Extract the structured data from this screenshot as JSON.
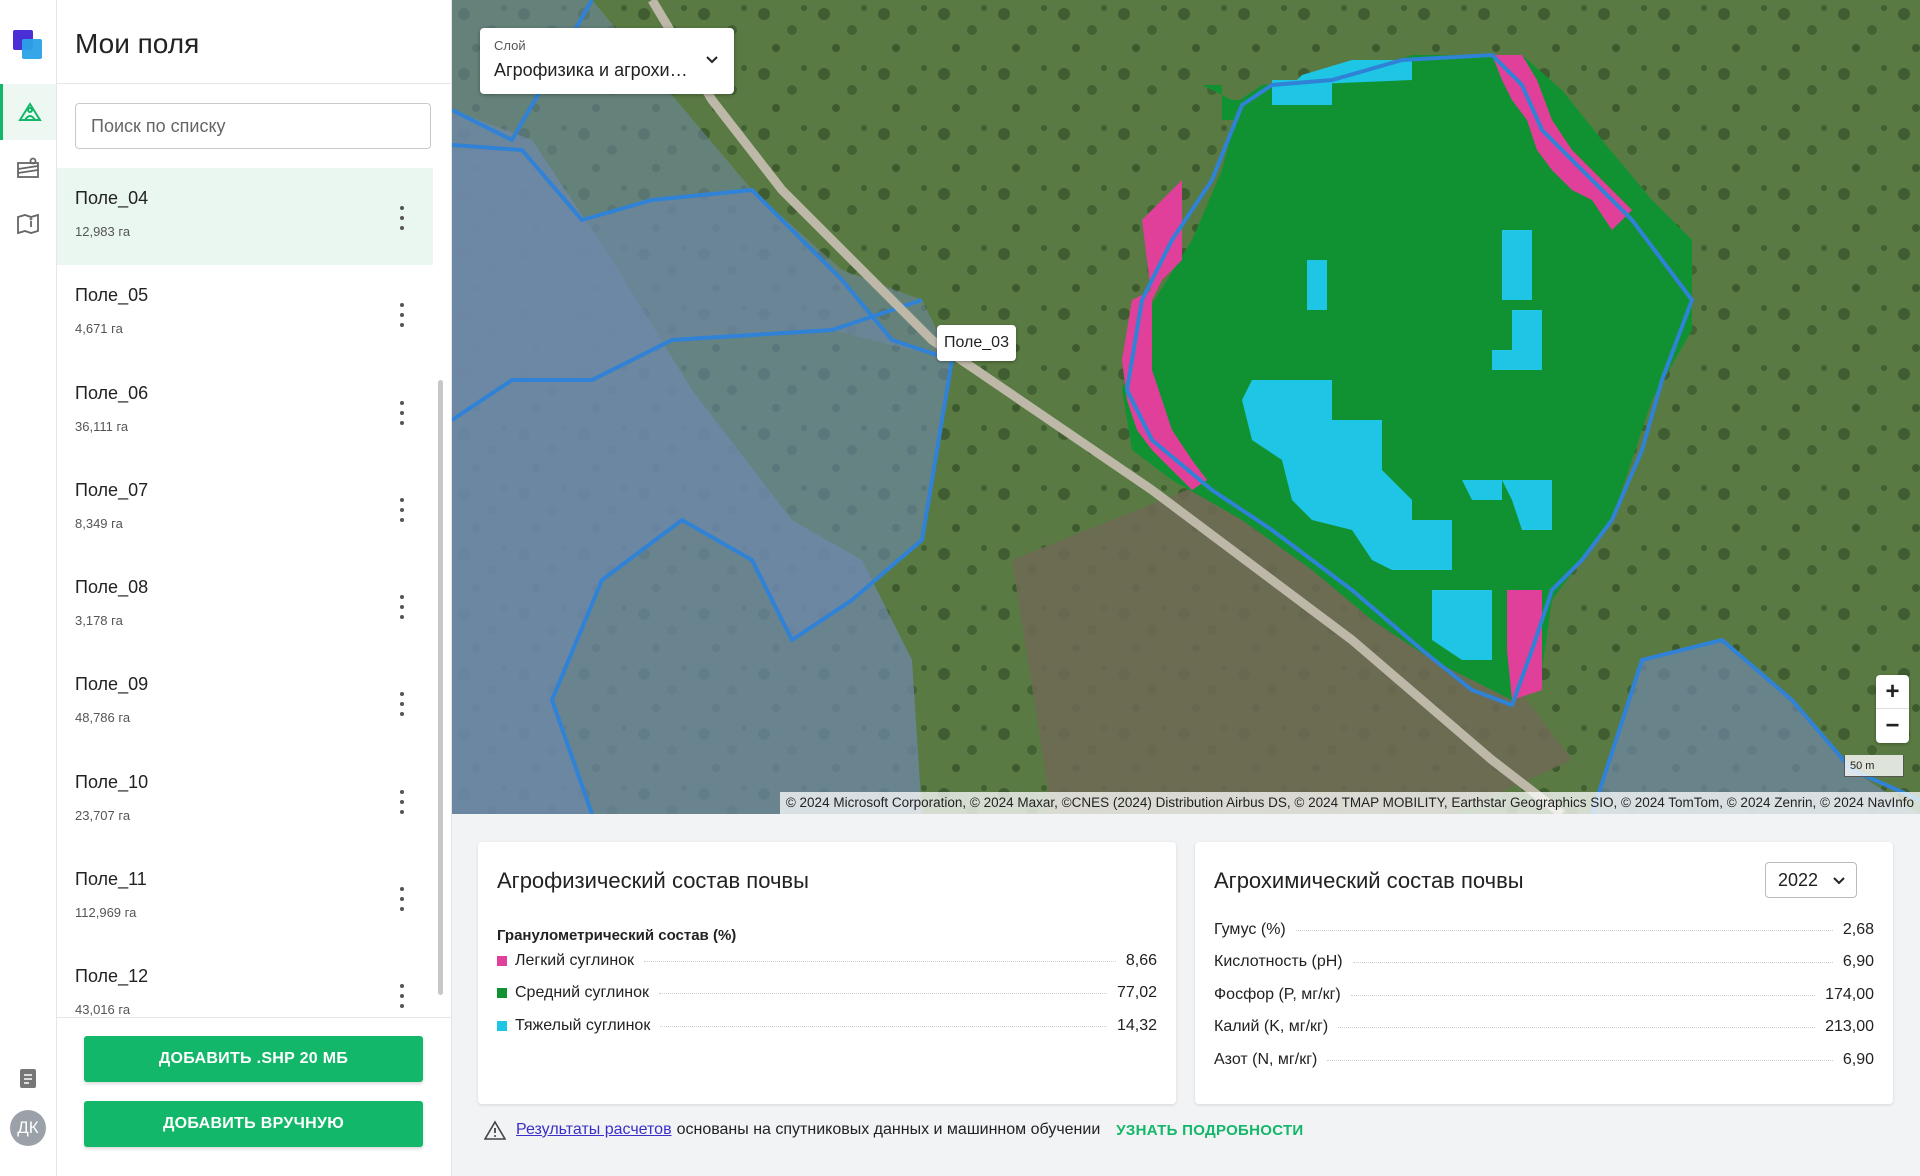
{
  "app": {
    "logo": "brand-logo"
  },
  "rail": {
    "items": [
      {
        "icon": "fields-icon",
        "active": true
      },
      {
        "icon": "weather-icon",
        "active": false
      },
      {
        "icon": "map-book-icon",
        "active": false
      }
    ],
    "bottom": {
      "notes_icon": "notes-icon",
      "avatar_initials": "ДК"
    }
  },
  "sidebar": {
    "title": "Мои поля",
    "search_placeholder": "Поиск по списку",
    "fields": [
      {
        "name": "Поле_04",
        "area": "12,983 га"
      },
      {
        "name": "Поле_05",
        "area": "4,671 га"
      },
      {
        "name": "Поле_06",
        "area": "36,111 га"
      },
      {
        "name": "Поле_07",
        "area": "8,349 га"
      },
      {
        "name": "Поле_08",
        "area": "3,178 га"
      },
      {
        "name": "Поле_09",
        "area": "48,786 га"
      },
      {
        "name": "Поле_10",
        "area": "23,707 га"
      },
      {
        "name": "Поле_11",
        "area": "112,969 га"
      },
      {
        "name": "Поле_12",
        "area": "43,016 га"
      }
    ],
    "btn_add_shp": "ДОБАВИТЬ .SHP 20 МБ",
    "btn_add_manual": "ДОБАВИТЬ ВРУЧНУЮ"
  },
  "map": {
    "layer_label": "Слой",
    "layer_value": "Агрофизика и агрохимия",
    "field_tag": "Поле_03",
    "zoom_in": "+",
    "zoom_out": "−",
    "scale": "50 m",
    "attribution": "© 2024 Microsoft Corporation, © 2024 Maxar, ©CNES (2024) Distribution Airbus DS, © 2024 TMAP MOBILITY, Earthstar Geographics SIO, © 2024 TomTom, © 2024 Zenrin, © 2024 NavInfo",
    "colors": {
      "light": "#e0409a",
      "medium": "#119232",
      "heavy": "#1ec5e4",
      "outline": "#2f82d6"
    }
  },
  "agrophysics": {
    "title": "Агрофизический состав почвы",
    "subtitle": "Гранулометрический состав (%)",
    "rows": [
      {
        "label": "Легкий суглинок",
        "value": "8,66",
        "color": "#e0409a"
      },
      {
        "label": "Средний суглинок",
        "value": "77,02",
        "color": "#119232"
      },
      {
        "label": "Тяжелый суглинок",
        "value": "14,32",
        "color": "#1ec5e4"
      }
    ]
  },
  "agrochemistry": {
    "title": "Агрохимический состав почвы",
    "year": "2022",
    "rows": [
      {
        "label": "Гумус (%)",
        "value": "2,68"
      },
      {
        "label": "Кислотность (pH)",
        "value": "6,90"
      },
      {
        "label": "Фосфор (P, мг/кг)",
        "value": "174,00"
      },
      {
        "label": "Калий (K, мг/кг)",
        "value": "213,00"
      },
      {
        "label": "Азот (N, мг/кг)",
        "value": "6,90"
      }
    ]
  },
  "note": {
    "link": "Результаты расчетов",
    "text": "основаны на спутниковых данных и машинном обучении",
    "more": "УЗНАТЬ ПОДРОБНОСТИ"
  }
}
